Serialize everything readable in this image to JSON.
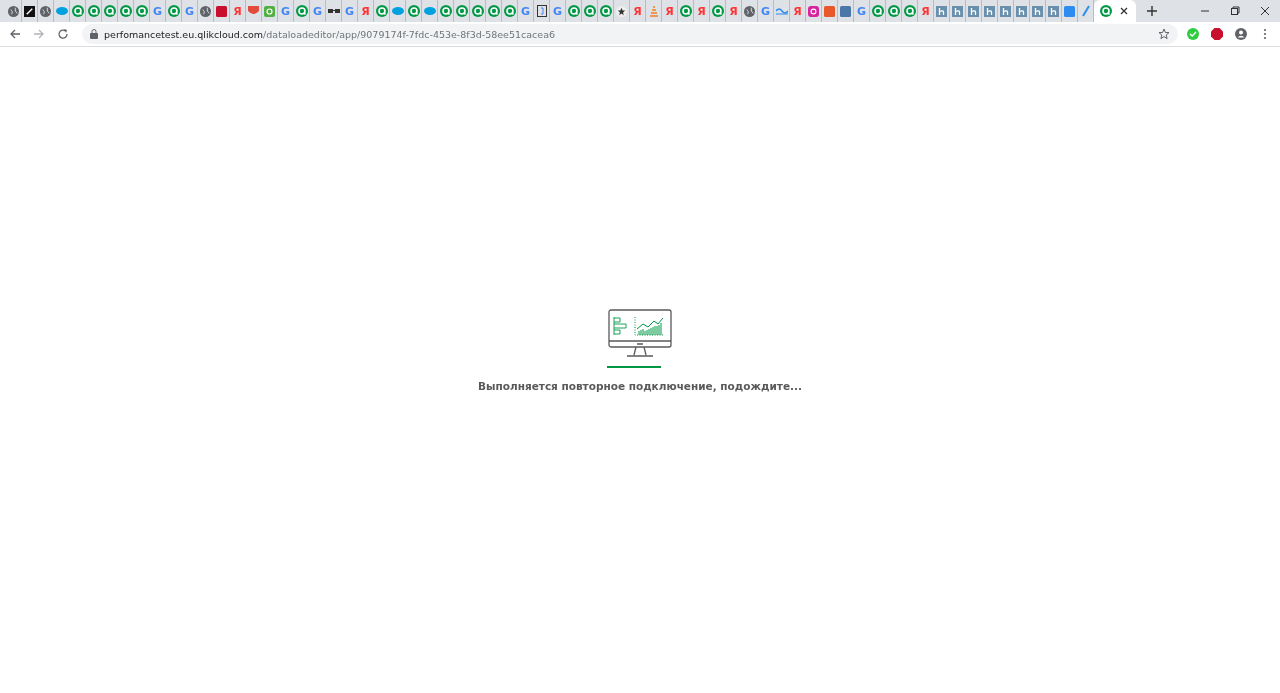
{
  "tabs": [
    {
      "kind": "globe",
      "selected": false
    },
    {
      "kind": "pen",
      "selected": false
    },
    {
      "kind": "globe",
      "selected": false
    },
    {
      "kind": "cloud",
      "selected": false
    },
    {
      "kind": "qlik",
      "selected": false
    },
    {
      "kind": "qlik",
      "selected": false
    },
    {
      "kind": "qlik",
      "selected": false
    },
    {
      "kind": "qlik",
      "selected": false
    },
    {
      "kind": "qlik",
      "selected": false
    },
    {
      "kind": "letter",
      "glyph": "G",
      "color": "#4285f4",
      "selected": false
    },
    {
      "kind": "qlik",
      "selected": false
    },
    {
      "kind": "letter",
      "glyph": "G",
      "color": "#4285f4",
      "selected": false
    },
    {
      "kind": "globe",
      "selected": false
    },
    {
      "kind": "square",
      "color": "#c8102e",
      "selected": false
    },
    {
      "kind": "letter",
      "glyph": "Я",
      "color": "#f33",
      "selected": false
    },
    {
      "kind": "shield",
      "selected": false
    },
    {
      "kind": "qsquare",
      "selected": false
    },
    {
      "kind": "letter",
      "glyph": "G",
      "color": "#4285f4",
      "selected": false
    },
    {
      "kind": "qlik",
      "selected": false
    },
    {
      "kind": "letter",
      "glyph": "G",
      "color": "#4285f4",
      "selected": false
    },
    {
      "kind": "glasses",
      "selected": false
    },
    {
      "kind": "letter",
      "glyph": "G",
      "color": "#4285f4",
      "selected": false
    },
    {
      "kind": "letter",
      "glyph": "Я",
      "color": "#f33",
      "selected": false
    },
    {
      "kind": "qlik",
      "selected": false
    },
    {
      "kind": "cloud",
      "selected": false
    },
    {
      "kind": "qlik",
      "selected": false
    },
    {
      "kind": "cloud",
      "selected": false
    },
    {
      "kind": "qlik",
      "selected": false
    },
    {
      "kind": "qlik",
      "selected": false
    },
    {
      "kind": "qlik",
      "selected": false
    },
    {
      "kind": "qlik",
      "selected": false
    },
    {
      "kind": "qlik",
      "selected": false
    },
    {
      "kind": "letter",
      "glyph": "G",
      "color": "#4285f4",
      "selected": false
    },
    {
      "kind": "bracket",
      "selected": false
    },
    {
      "kind": "letter",
      "glyph": "G",
      "color": "#4285f4",
      "selected": false
    },
    {
      "kind": "qlik",
      "selected": false
    },
    {
      "kind": "qlik",
      "selected": false
    },
    {
      "kind": "qlik",
      "selected": false
    },
    {
      "kind": "star",
      "selected": false
    },
    {
      "kind": "letter",
      "glyph": "Я",
      "color": "#f33",
      "selected": false
    },
    {
      "kind": "stack",
      "selected": false
    },
    {
      "kind": "letter",
      "glyph": "Я",
      "color": "#f33",
      "selected": false
    },
    {
      "kind": "qlik",
      "selected": false
    },
    {
      "kind": "letter",
      "glyph": "Я",
      "color": "#f33",
      "selected": false
    },
    {
      "kind": "qlik",
      "selected": false
    },
    {
      "kind": "letter",
      "glyph": "Я",
      "color": "#f33",
      "selected": false
    },
    {
      "kind": "globe",
      "selected": false
    },
    {
      "kind": "letter",
      "glyph": "G",
      "color": "#4285f4",
      "selected": false
    },
    {
      "kind": "wave",
      "selected": false
    },
    {
      "kind": "letter",
      "glyph": "Я",
      "color": "#f33",
      "selected": false
    },
    {
      "kind": "camera",
      "selected": false
    },
    {
      "kind": "square",
      "color": "#e8582a",
      "selected": false
    },
    {
      "kind": "square",
      "color": "#4a76a8",
      "selected": false
    },
    {
      "kind": "letter",
      "glyph": "G",
      "color": "#4285f4",
      "selected": false
    },
    {
      "kind": "qlik",
      "selected": false
    },
    {
      "kind": "qlik",
      "selected": false
    },
    {
      "kind": "qlik",
      "selected": false
    },
    {
      "kind": "letter",
      "glyph": "Я",
      "color": "#f33",
      "selected": false
    },
    {
      "kind": "tile",
      "selected": false
    },
    {
      "kind": "tile",
      "selected": false
    },
    {
      "kind": "tile",
      "selected": false
    },
    {
      "kind": "tile",
      "selected": false
    },
    {
      "kind": "tile",
      "selected": false
    },
    {
      "kind": "tile",
      "selected": false
    },
    {
      "kind": "tile",
      "selected": false
    },
    {
      "kind": "tile",
      "selected": false
    },
    {
      "kind": "square",
      "color": "#2d8cf0",
      "selected": false
    },
    {
      "kind": "slash",
      "selected": false
    },
    {
      "kind": "qlik",
      "selected": true
    }
  ],
  "address_bar": {
    "host": "perfomancetest.eu.qlikcloud.com",
    "path": "/dataloadeditor/app/9079174f-7fdc-453e-8f3d-58ee51cacea6"
  },
  "message": "Выполняется повторное подключение, подождите..."
}
